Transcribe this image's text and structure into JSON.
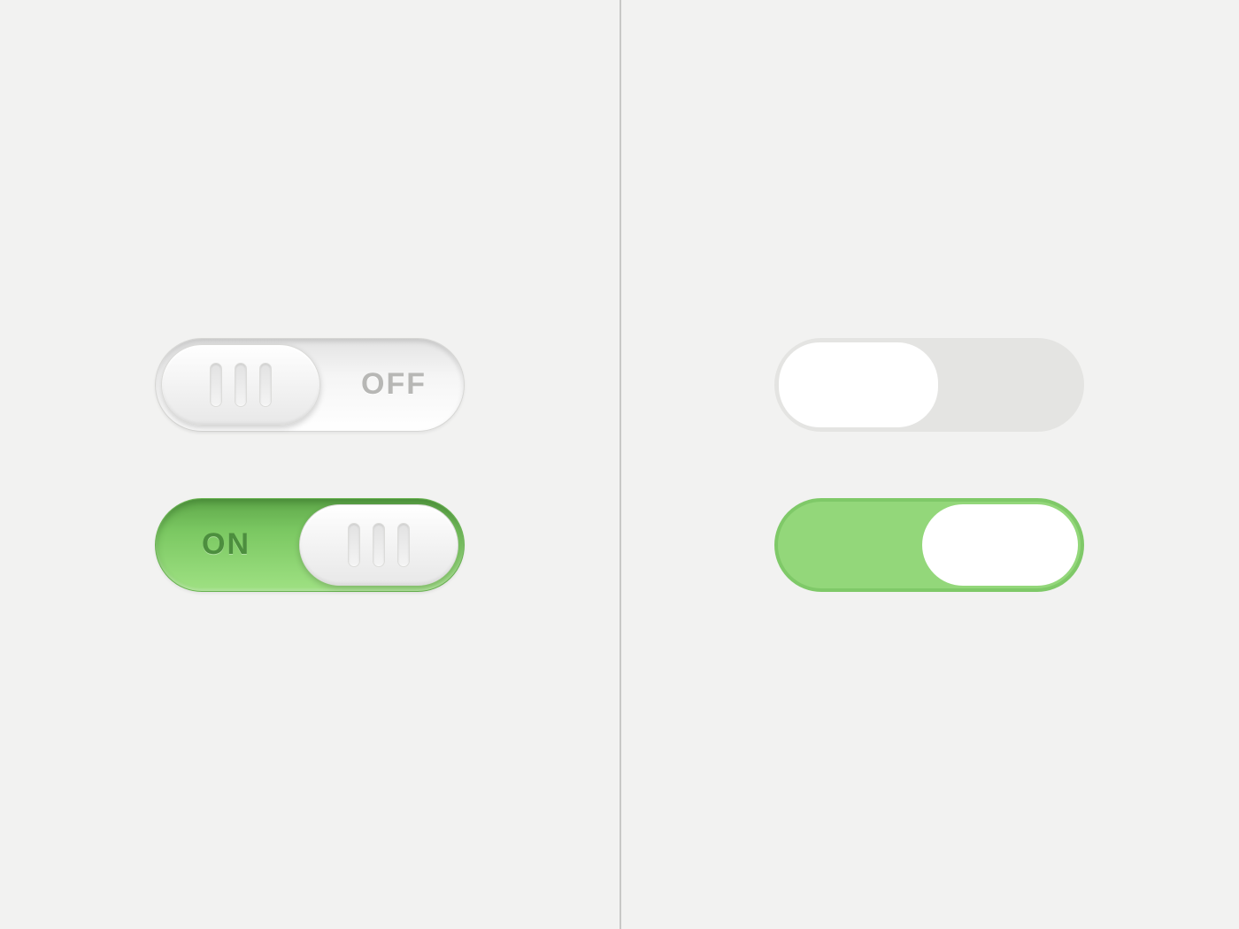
{
  "left": {
    "off_label": "OFF",
    "on_label": "ON"
  },
  "colors": {
    "bg": "#f2f2f1",
    "green": "#93d77a",
    "green_border": "#7fc968",
    "grey_track": "#e4e4e2",
    "knob": "#ffffff"
  }
}
